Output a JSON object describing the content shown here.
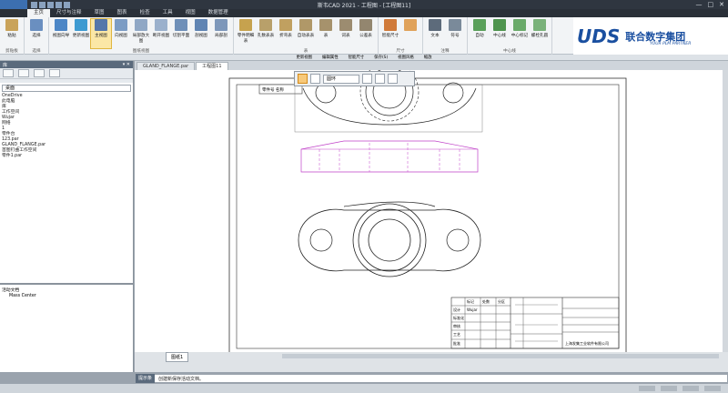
{
  "window": {
    "title": "斯韦CAD 2021 - 工程图 - [工程图11]",
    "controls": [
      "—",
      "□",
      "✕"
    ]
  },
  "menu": {
    "items": [
      "主页",
      "尺寸与注释",
      "草图",
      "图表",
      "检查",
      "工具",
      "视图",
      "数据管理"
    ],
    "active_index": 0
  },
  "ribbon": {
    "groups": [
      {
        "label": "剪贴板",
        "buttons": [
          "粘贴"
        ]
      },
      {
        "label": "选择",
        "buttons": [
          "选择"
        ]
      },
      {
        "label": "图纸视图",
        "buttons": [
          "视图向导",
          "更新视图",
          "主视图",
          "向视图",
          "局部放大图",
          "断开视图",
          "切割平面",
          "剖视图",
          "局部剖"
        ]
      },
      {
        "label": "表",
        "buttons": [
          "零件明细表",
          "孔数表表",
          "折弯表",
          "自动表表",
          "表",
          "词表",
          "公差表"
        ]
      },
      {
        "label": "尺寸",
        "buttons": [
          "智能尺寸"
        ]
      },
      {
        "label": "注释",
        "buttons": [
          "文本",
          "符号"
        ]
      },
      {
        "label": "中心线",
        "buttons": [
          "自动",
          "中心线",
          "中心标记",
          "螺栓孔圆"
        ]
      }
    ]
  },
  "brand": {
    "logo": "UDS",
    "name": "联合数字集团",
    "tagline": "YOUR PLM PARTNER"
  },
  "strip": {
    "items": [
      "更新视图",
      "编辑属性",
      "智能尺寸",
      "保存(S)",
      "视图风格",
      "缩放"
    ]
  },
  "left_pane": {
    "header": "库",
    "select": "桌面",
    "tree": [
      "桌面",
      "OneDrive",
      "此电脑",
      "库",
      "工作空间",
      "Wujar",
      "网络",
      "1",
      "零件台",
      "123.par",
      "GLAND_FLANGE.par",
      "首图钉曲工作空间",
      "零件1.par"
    ],
    "tree2": [
      "活动文档",
      "Mass Center"
    ]
  },
  "doc_tabs": [
    "GLAND_FLANGE.par",
    "工程图11"
  ],
  "active_doc_tab": 1,
  "mini_toolbar": {
    "dropdown": "圆环"
  },
  "title_block": {
    "row_labels": [
      "标记",
      "处数",
      "分区",
      "签字",
      "日期"
    ],
    "cells": [
      "设计",
      "Wujar",
      "标准化",
      "审核",
      "工艺",
      "批准"
    ],
    "company": "上海发集工业软件有限公司",
    "note": "零件号 名称"
  },
  "sheet_tab": "图纸1",
  "prompt": {
    "label": "提示条",
    "text": "创建新保存活动文档。"
  },
  "colors": {
    "accent": "#3c6fb0",
    "magenta": "#c040c8"
  }
}
